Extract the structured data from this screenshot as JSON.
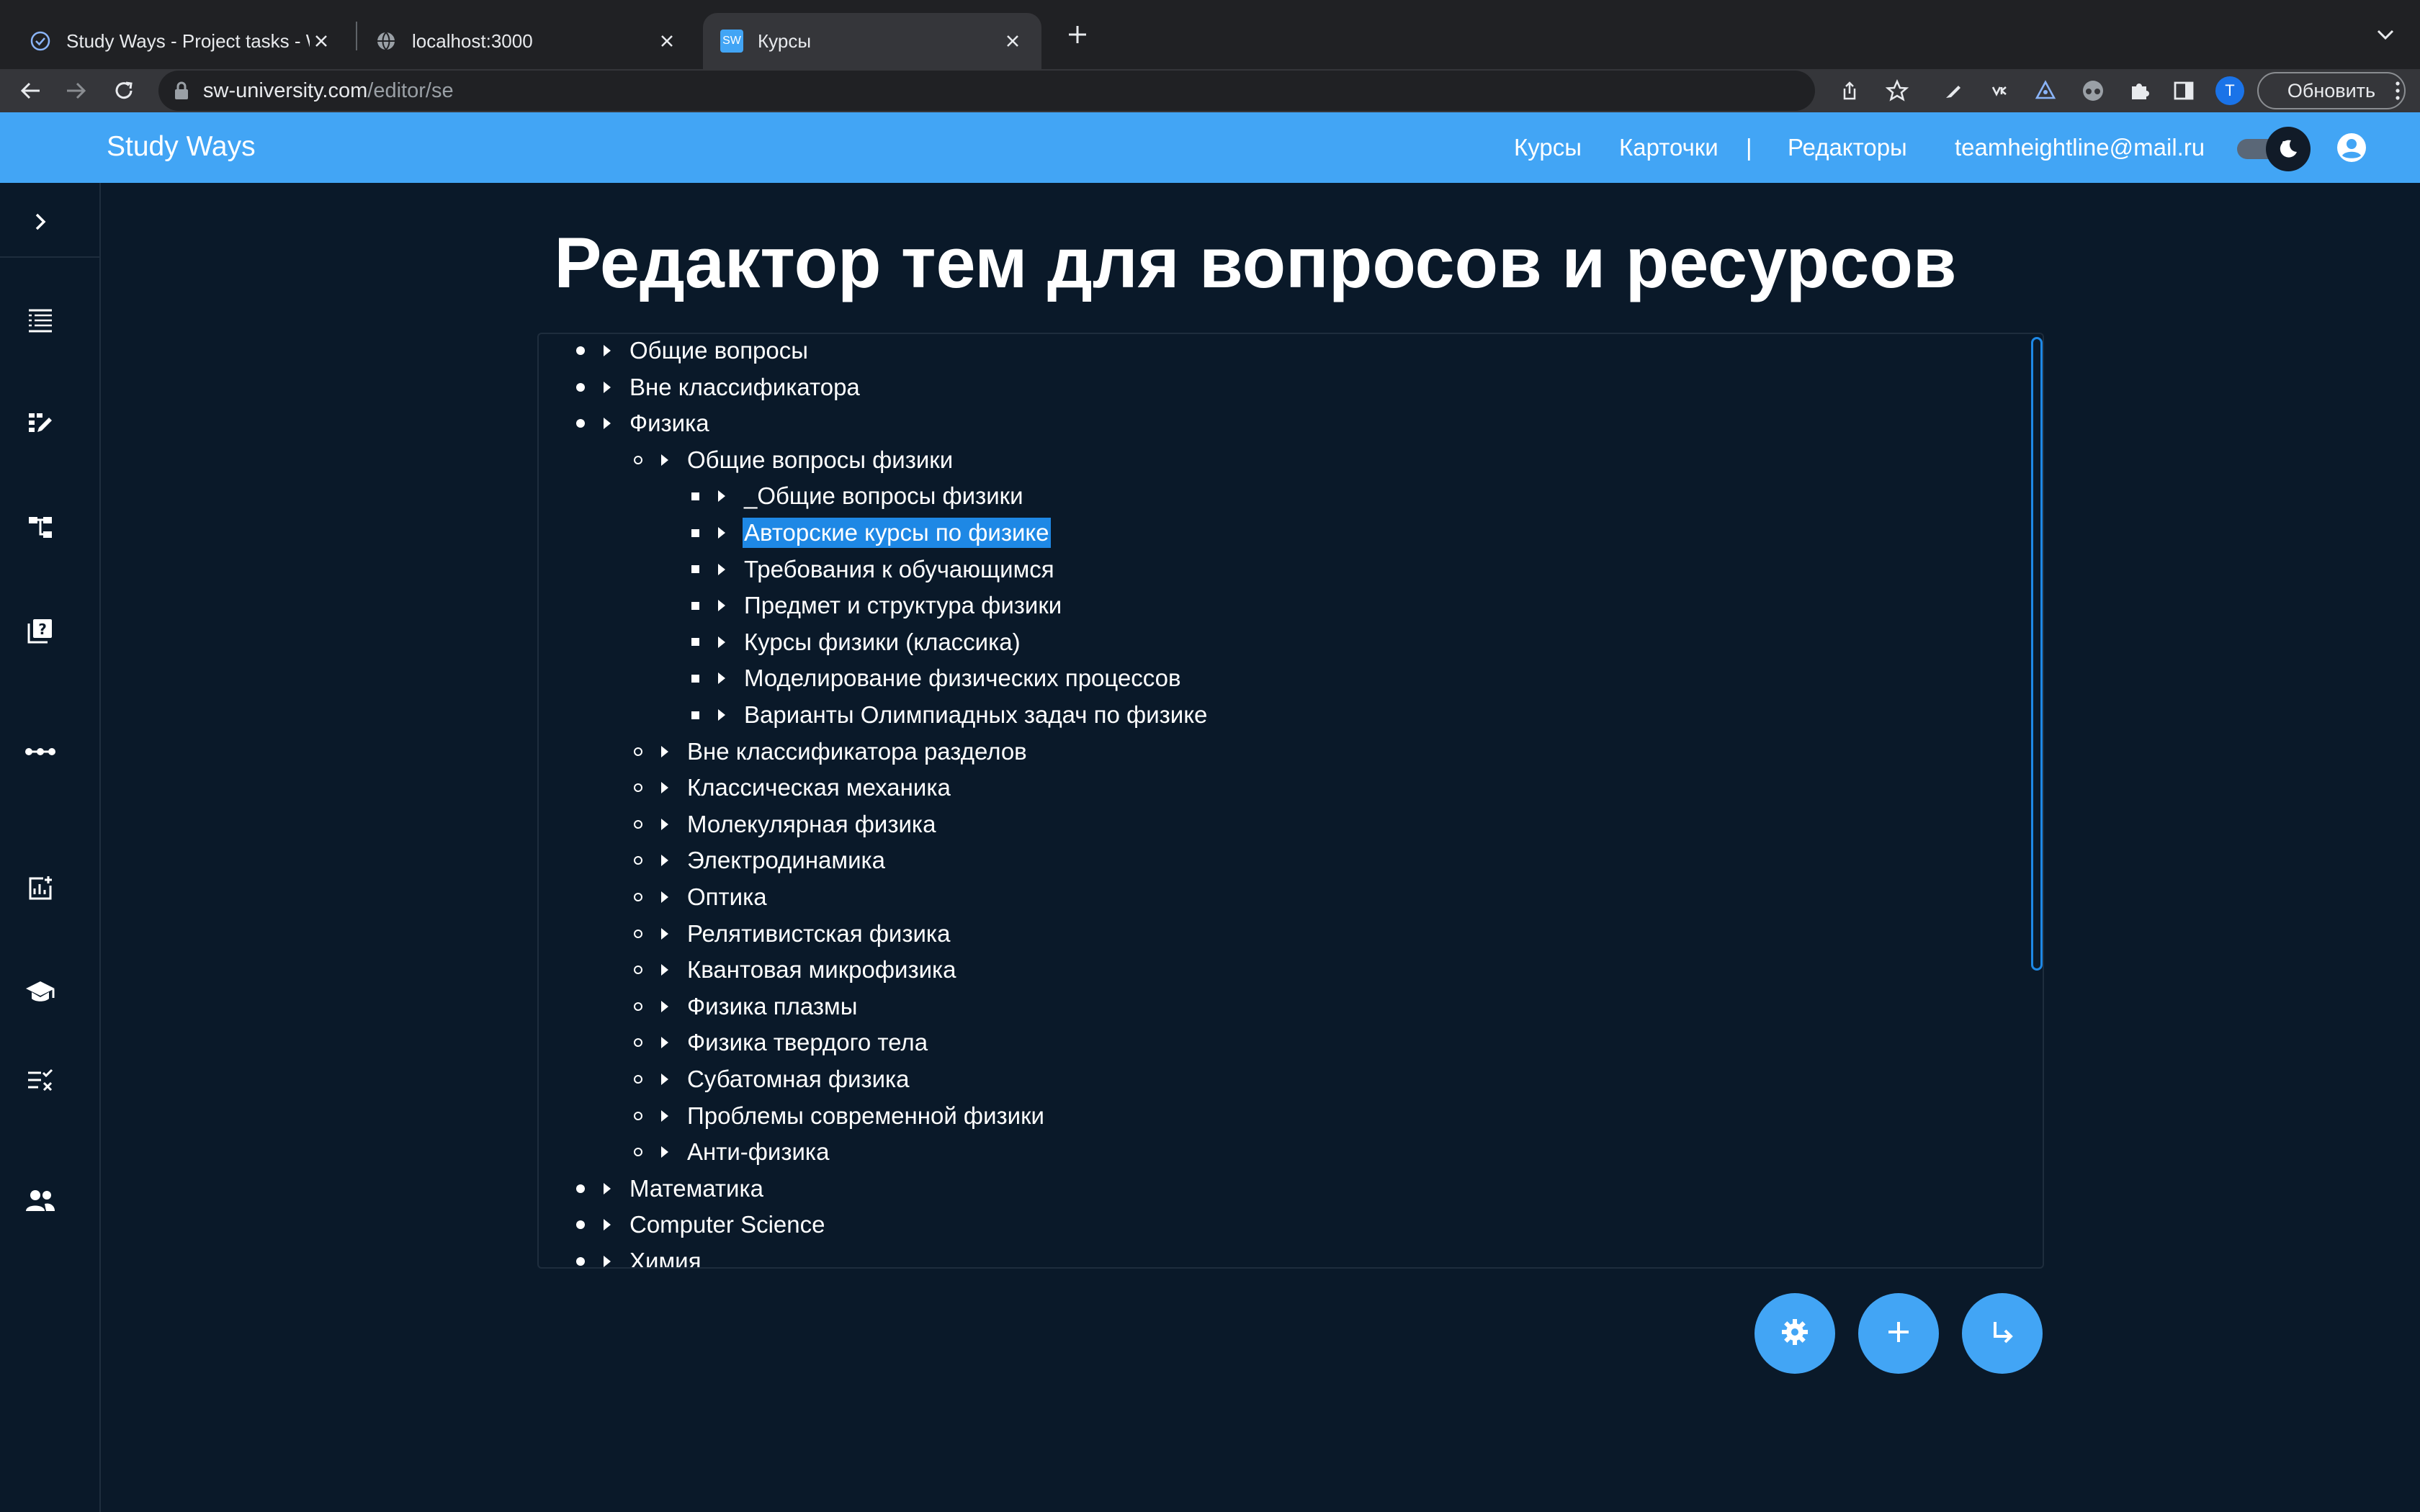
{
  "browser": {
    "tabs": [
      {
        "title": "Study Ways - Project tasks - W",
        "favicon": "check-circle-icon",
        "active": false
      },
      {
        "title": "localhost:3000",
        "favicon": "globe-icon",
        "active": false
      },
      {
        "title": "Курсы",
        "favicon": "sw-logo-icon",
        "favicon_text": "SW",
        "active": true
      }
    ],
    "url_host": "sw-university.com",
    "url_path": "/editor/se",
    "update_label": "Обновить",
    "profile_initial": "T"
  },
  "app": {
    "brand": "Study Ways",
    "nav": {
      "courses": "Курсы",
      "cards": "Карточки",
      "separator": "|",
      "editors": "Редакторы",
      "email": "teamheightline@mail.ru"
    },
    "accent_color": "#42a5f5",
    "background_color": "#0a1929"
  },
  "sidebar": {
    "items": [
      {
        "icon": "chevron-right-icon"
      },
      {
        "icon": "table-rows-icon"
      },
      {
        "icon": "edit-grid-icon"
      },
      {
        "icon": "hierarchy-icon"
      },
      {
        "icon": "quiz-icon"
      },
      {
        "icon": "more-horizontal-icon"
      },
      {
        "icon": "add-chart-icon"
      },
      {
        "icon": "school-icon"
      },
      {
        "icon": "checklist-icon"
      },
      {
        "icon": "people-icon"
      }
    ]
  },
  "main": {
    "title": "Редактор тем для вопросов и ресурсов",
    "tree": [
      {
        "level": 1,
        "label": "Общие вопросы"
      },
      {
        "level": 1,
        "label": "Вне классификатора"
      },
      {
        "level": 1,
        "label": "Физика"
      },
      {
        "level": 2,
        "label": "Общие вопросы физики"
      },
      {
        "level": 3,
        "label": "_Общие вопросы физики"
      },
      {
        "level": 3,
        "label": "Авторские курсы по физике",
        "selected": true
      },
      {
        "level": 3,
        "label": "Требования к обучающимся"
      },
      {
        "level": 3,
        "label": "Предмет и структура физики"
      },
      {
        "level": 3,
        "label": "Курсы физики (классика)"
      },
      {
        "level": 3,
        "label": "Моделирование физических процессов"
      },
      {
        "level": 3,
        "label": "Варианты Олимпиадных задач по физике"
      },
      {
        "level": 2,
        "label": "Вне классификатора разделов"
      },
      {
        "level": 2,
        "label": "Классическая механика"
      },
      {
        "level": 2,
        "label": "Молекулярная физика"
      },
      {
        "level": 2,
        "label": "Электродинамика"
      },
      {
        "level": 2,
        "label": "Оптика"
      },
      {
        "level": 2,
        "label": "Релятивистская физика"
      },
      {
        "level": 2,
        "label": "Квантовая микрофизика"
      },
      {
        "level": 2,
        "label": "Физика плазмы"
      },
      {
        "level": 2,
        "label": "Физика твердого тела"
      },
      {
        "level": 2,
        "label": "Субатомная физика"
      },
      {
        "level": 2,
        "label": "Проблемы современной физики"
      },
      {
        "level": 2,
        "label": "Анти-физика"
      },
      {
        "level": 1,
        "label": "Математика"
      },
      {
        "level": 1,
        "label": "Computer Science"
      },
      {
        "level": 1,
        "label": "Химия"
      }
    ],
    "actions": [
      {
        "icon": "settings-icon"
      },
      {
        "icon": "plus-icon"
      },
      {
        "icon": "subdirectory-arrow-icon"
      }
    ]
  }
}
